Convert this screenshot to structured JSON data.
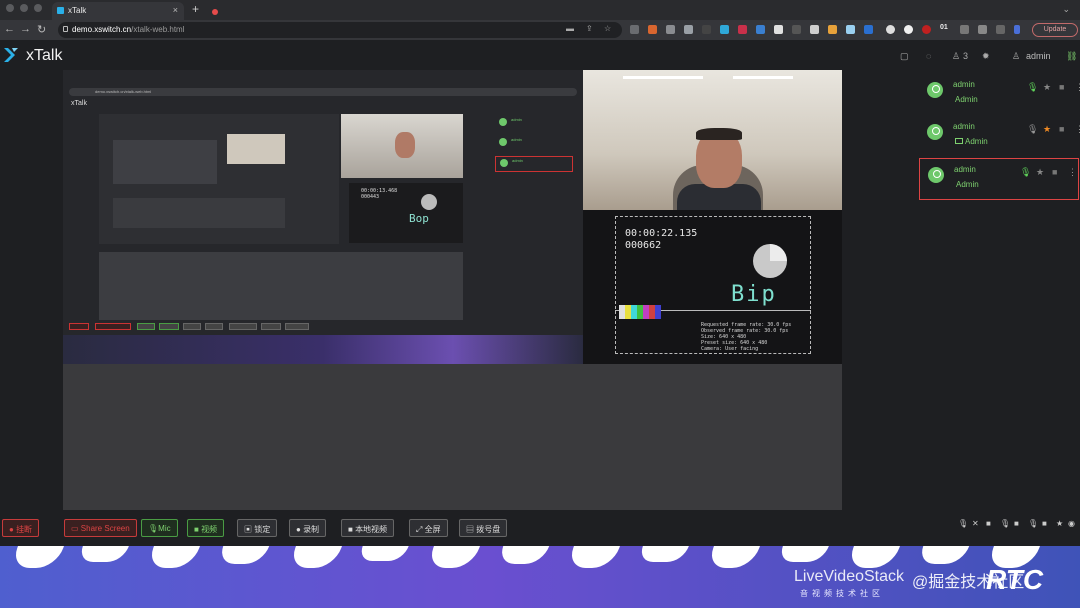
{
  "browser": {
    "tab_title": "xTalk",
    "new_tab": "+",
    "tab_close": "×",
    "url_host": "demo.xswitch.cn",
    "url_path": "/xtalk-web.html",
    "extension_badge": "01",
    "update_label": "Update"
  },
  "app": {
    "title": "xTalk",
    "header": {
      "user_count": "3",
      "user_name": "admin"
    }
  },
  "participants": [
    {
      "name": "admin",
      "role": "Admin",
      "screen_share": false,
      "mic": "active",
      "star": "gray",
      "selected": false
    },
    {
      "name": "admin",
      "role": "Admin",
      "screen_share": true,
      "mic": "muted",
      "star": "orange",
      "selected": false
    },
    {
      "name": "admin",
      "role": "Admin",
      "screen_share": false,
      "mic": "active",
      "star": "gray",
      "selected": true
    }
  ],
  "test_card": {
    "timecode": "00:00:22.135",
    "frame": "000662",
    "word": "Bip",
    "stats": "Requested frame rate: 30.0 fps\nObserved frame rate: 30.0 fps\nSize: 640 x 480\nPreset size: 640 x 480\nCamera: User facing"
  },
  "nested_screen": {
    "url": "demo.xswitch.cn/xtalk-web.html",
    "logo": "xTalk",
    "timecode": "00:00:13.468",
    "frame": "000443",
    "word": "Bop",
    "participant_name": "admin"
  },
  "controls": {
    "hangup": "挂断",
    "stop_share": "Share Screen",
    "mic": "Mic",
    "video": "视频",
    "lock": "锁定",
    "record": "录制",
    "local_video": "本地视频",
    "fullscreen": "全屏",
    "dialpad": "拨号盘"
  },
  "banner": {
    "brand": "LiveVideoStack",
    "subtitle": "音视频技术社区",
    "rtc": "RTC",
    "overlay_cn": "@掘金技术社区"
  },
  "colors": {
    "accent_green": "#7ed16f",
    "danger_red": "#d44444",
    "star_orange": "#f08a24",
    "banner_blue": "#4f5fcf"
  }
}
